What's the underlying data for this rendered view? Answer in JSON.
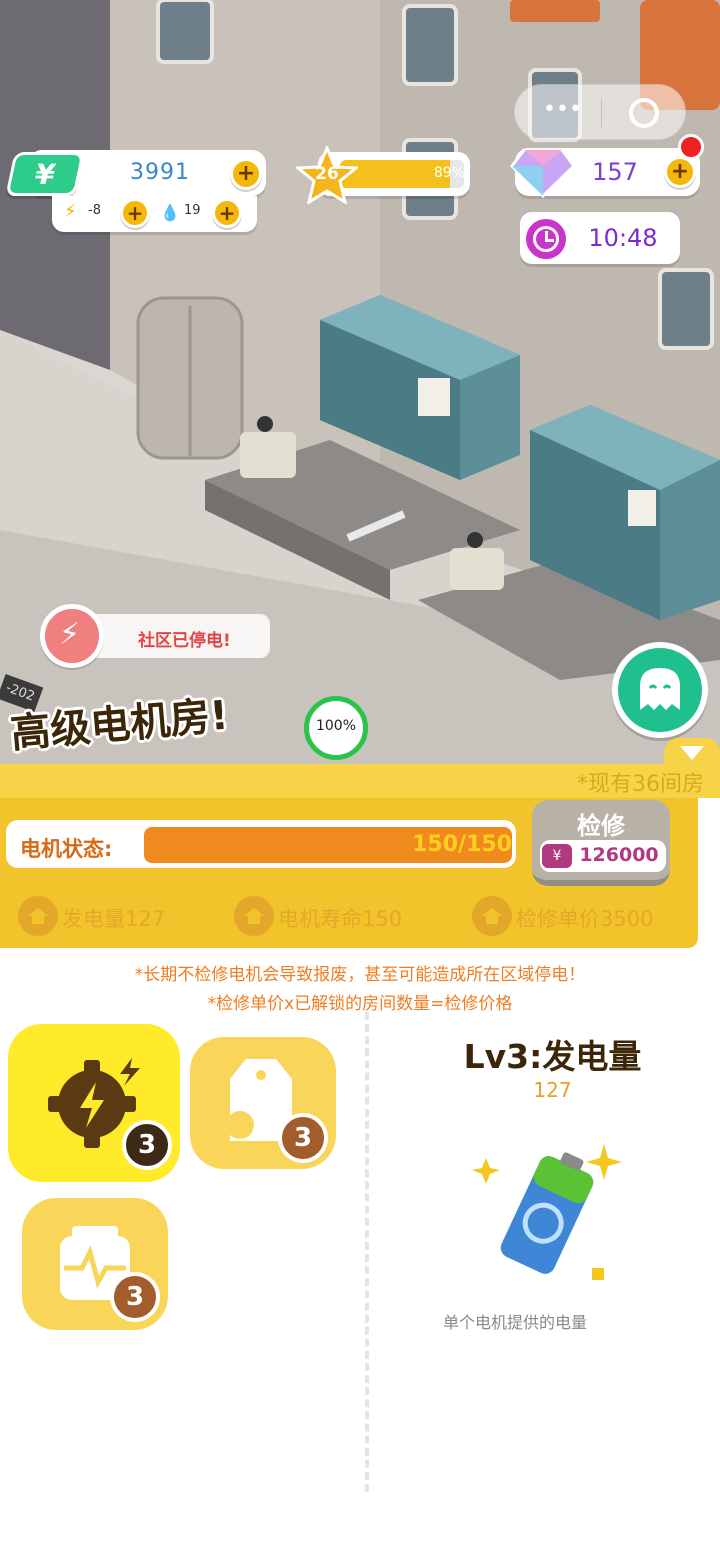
{
  "hud": {
    "cash": "3991",
    "cash_icon": "yen-icon",
    "power": "-8",
    "water": "19",
    "level": "26",
    "level_progress_percent": 89,
    "level_progress_label": "89%",
    "gems": "157",
    "clock": "10:48"
  },
  "scene": {
    "notice": "社区已停电!",
    "room_title": "高级电机房!",
    "room_percent": "100%",
    "room_number": "-202"
  },
  "panel": {
    "rooms_owned": "*现有36间房",
    "status_label": "电机状态:",
    "status_value": "150/150",
    "status_progress_percent": 100,
    "repair_label": "检修",
    "repair_currency": "¥",
    "repair_price": "126000",
    "stats": [
      {
        "label": "发电量127"
      },
      {
        "label": "电机寿命150"
      },
      {
        "label": "检修单价3500"
      }
    ],
    "warning_1": "*长期不检修电机会导致报废，甚至可能造成所在区域停电！",
    "warning_2": "*检修单价x已解锁的房间数量=检修价格"
  },
  "upgrades": {
    "cards": [
      {
        "icon": "gear-lightning-icon",
        "level": "3",
        "selected": true
      },
      {
        "icon": "tag-wrench-icon",
        "level": "3",
        "selected": false
      },
      {
        "icon": "generator-pulse-icon",
        "level": "3",
        "selected": false
      }
    ],
    "detail_title": "Lv3:发电量",
    "detail_value": "127",
    "detail_icon": "battery-recycle-icon",
    "detail_desc": "单个电机提供的电量"
  },
  "colors": {
    "panel_yellow": "#f2c42b",
    "status_orange": "#ef8a1f",
    "cash_green": "#2ecc8a",
    "gem_purple": "#7b3fd6",
    "warning_orange": "#ef7d22"
  }
}
